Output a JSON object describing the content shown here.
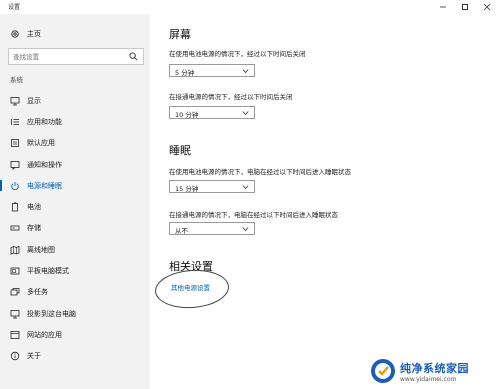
{
  "window": {
    "title": "设置"
  },
  "sidebar": {
    "home_label": "主页",
    "search_placeholder": "查找设置",
    "group_label": "系统",
    "items": [
      {
        "label": "显示",
        "icon": "monitor-icon"
      },
      {
        "label": "应用和功能",
        "icon": "apps-list-icon"
      },
      {
        "label": "默认应用",
        "icon": "default-apps-icon"
      },
      {
        "label": "通知和操作",
        "icon": "notification-icon"
      },
      {
        "label": "电源和睡眠",
        "icon": "power-icon",
        "active": true
      },
      {
        "label": "电池",
        "icon": "battery-icon"
      },
      {
        "label": "存储",
        "icon": "storage-icon"
      },
      {
        "label": "离线地图",
        "icon": "offline-maps-icon"
      },
      {
        "label": "平板电脑模式",
        "icon": "tablet-mode-icon"
      },
      {
        "label": "多任务",
        "icon": "multitasking-icon"
      },
      {
        "label": "投影到这台电脑",
        "icon": "project-icon"
      },
      {
        "label": "网站的应用",
        "icon": "apps-for-websites-icon"
      },
      {
        "label": "关于",
        "icon": "info-icon"
      }
    ]
  },
  "screen": {
    "heading": "屏幕",
    "battery_label": "在使用电池电源的情况下，经过以下时间后关闭",
    "battery_value": "5 分钟",
    "plugged_label": "在接通电源的情况下，经过以下时间后关闭",
    "plugged_value": "10 分钟"
  },
  "sleep": {
    "heading": "睡眠",
    "battery_label": "在使用电池电源的情况下，电脑在经过以下时间后进入睡眠状态",
    "battery_value": "15 分钟",
    "plugged_label": "在接通电源的情况下，电脑在经过以下时间后进入睡眠状态",
    "plugged_value": "从不"
  },
  "related": {
    "heading": "相关设置",
    "link_label": "其他电源设置"
  },
  "watermark": {
    "name": "纯净系统家园",
    "url": "www.yidaimei.com"
  },
  "colors": {
    "accent": "#0063b1",
    "sidebar_bg": "#f2f2f2"
  }
}
